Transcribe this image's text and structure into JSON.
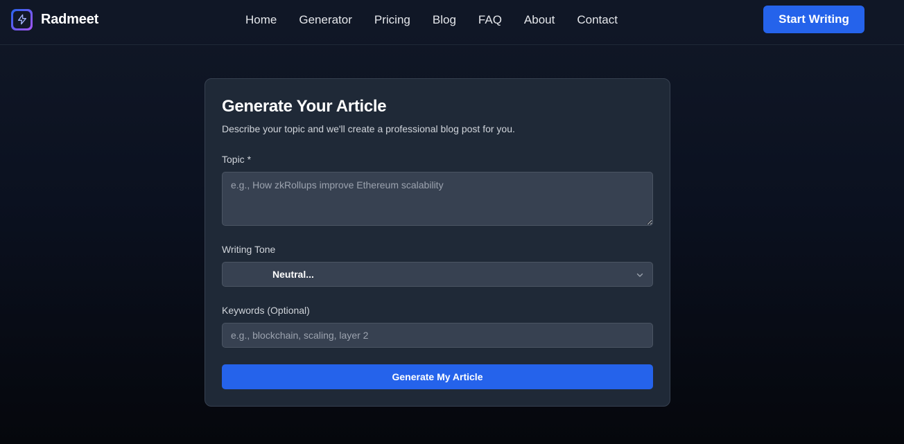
{
  "header": {
    "brand": "Radmeet",
    "logo_icon": "lightning-bolt-icon",
    "nav": [
      "Home",
      "Generator",
      "Pricing",
      "Blog",
      "FAQ",
      "About",
      "Contact"
    ],
    "cta_label": "Start Writing"
  },
  "form": {
    "title": "Generate Your Article",
    "subtitle": "Describe your topic and we'll create a professional blog post for you.",
    "topic_label": "Topic *",
    "topic_placeholder": "e.g., How zkRollups improve Ethereum scalability",
    "tone_label": "Writing Tone",
    "tone_value": "Neutral...",
    "keywords_label": "Keywords (Optional)",
    "keywords_placeholder": "e.g., blockchain, scaling, layer 2",
    "submit_label": "Generate My Article"
  },
  "colors": {
    "accent": "#2563eb",
    "card_bg": "#1f2937",
    "field_bg": "#374151"
  }
}
